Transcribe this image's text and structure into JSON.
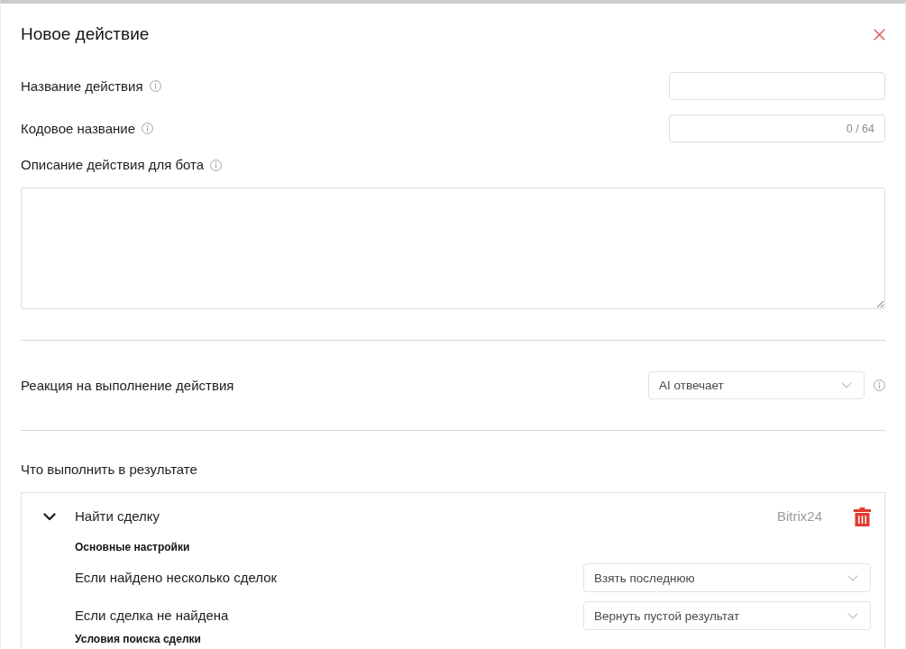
{
  "dialog": {
    "title": "Новое действие",
    "fields": [
      {
        "kind": "input",
        "label": "Название действия"
      },
      {
        "kind": "input",
        "label": "Кодовое название",
        "counter": "0 / 64"
      },
      {
        "kind": "textarea",
        "label": "Описание действия для бота"
      }
    ],
    "reaction": {
      "label": "Реакция на выполнение действия",
      "value": "AI отвечает"
    },
    "results": {
      "title": "Что выполнить в результате",
      "actions": [
        {
          "name": "Найти сделку",
          "source": "Bitrix24",
          "expanded": true,
          "sections": [
            {
              "title": "Основные настройки",
              "settings": [
                {
                  "label": "Если найдено несколько сделок",
                  "value": "Взять последнюю"
                },
                {
                  "label": "Если сделка не найдена",
                  "value": "Вернуть пустой результат"
                }
              ]
            },
            {
              "title": "Условия поиска сделки"
            }
          ]
        }
      ]
    }
  }
}
